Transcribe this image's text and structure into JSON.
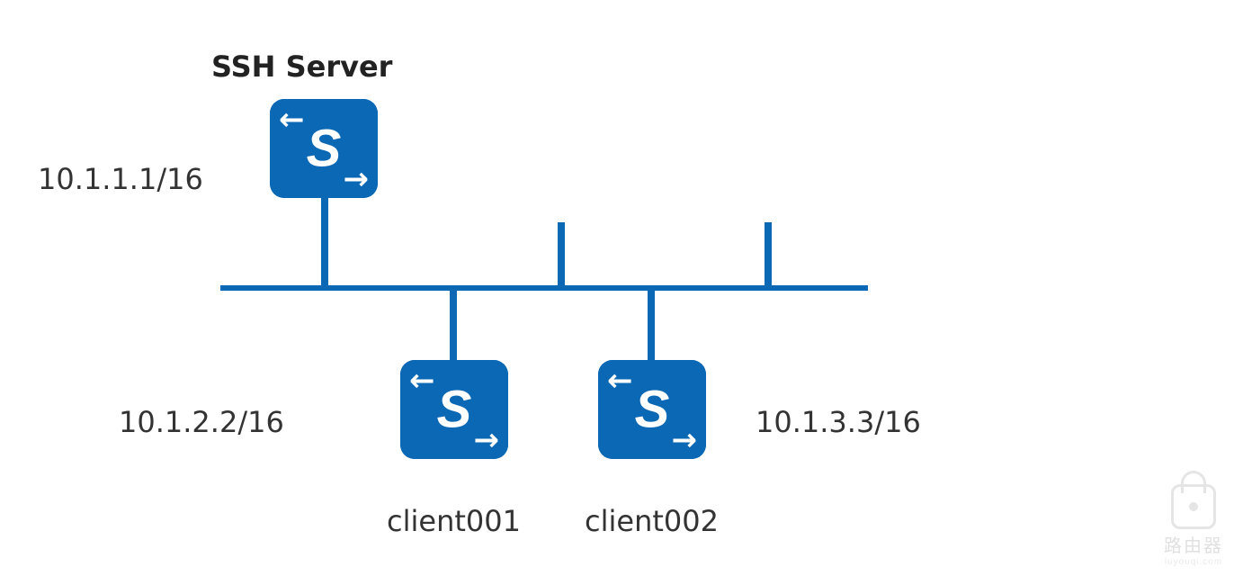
{
  "colors": {
    "accent": "#0b68b5",
    "text": "#333333"
  },
  "server": {
    "title": "SSH Server",
    "ip": "10.1.1.1/16"
  },
  "clients": [
    {
      "name": "client001",
      "ip": "10.1.2.2/16"
    },
    {
      "name": "client002",
      "ip": "10.1.3.3/16"
    }
  ],
  "icon_glyph": "S",
  "watermark": {
    "line1": "路由器",
    "line2": "luyouqi.com"
  }
}
